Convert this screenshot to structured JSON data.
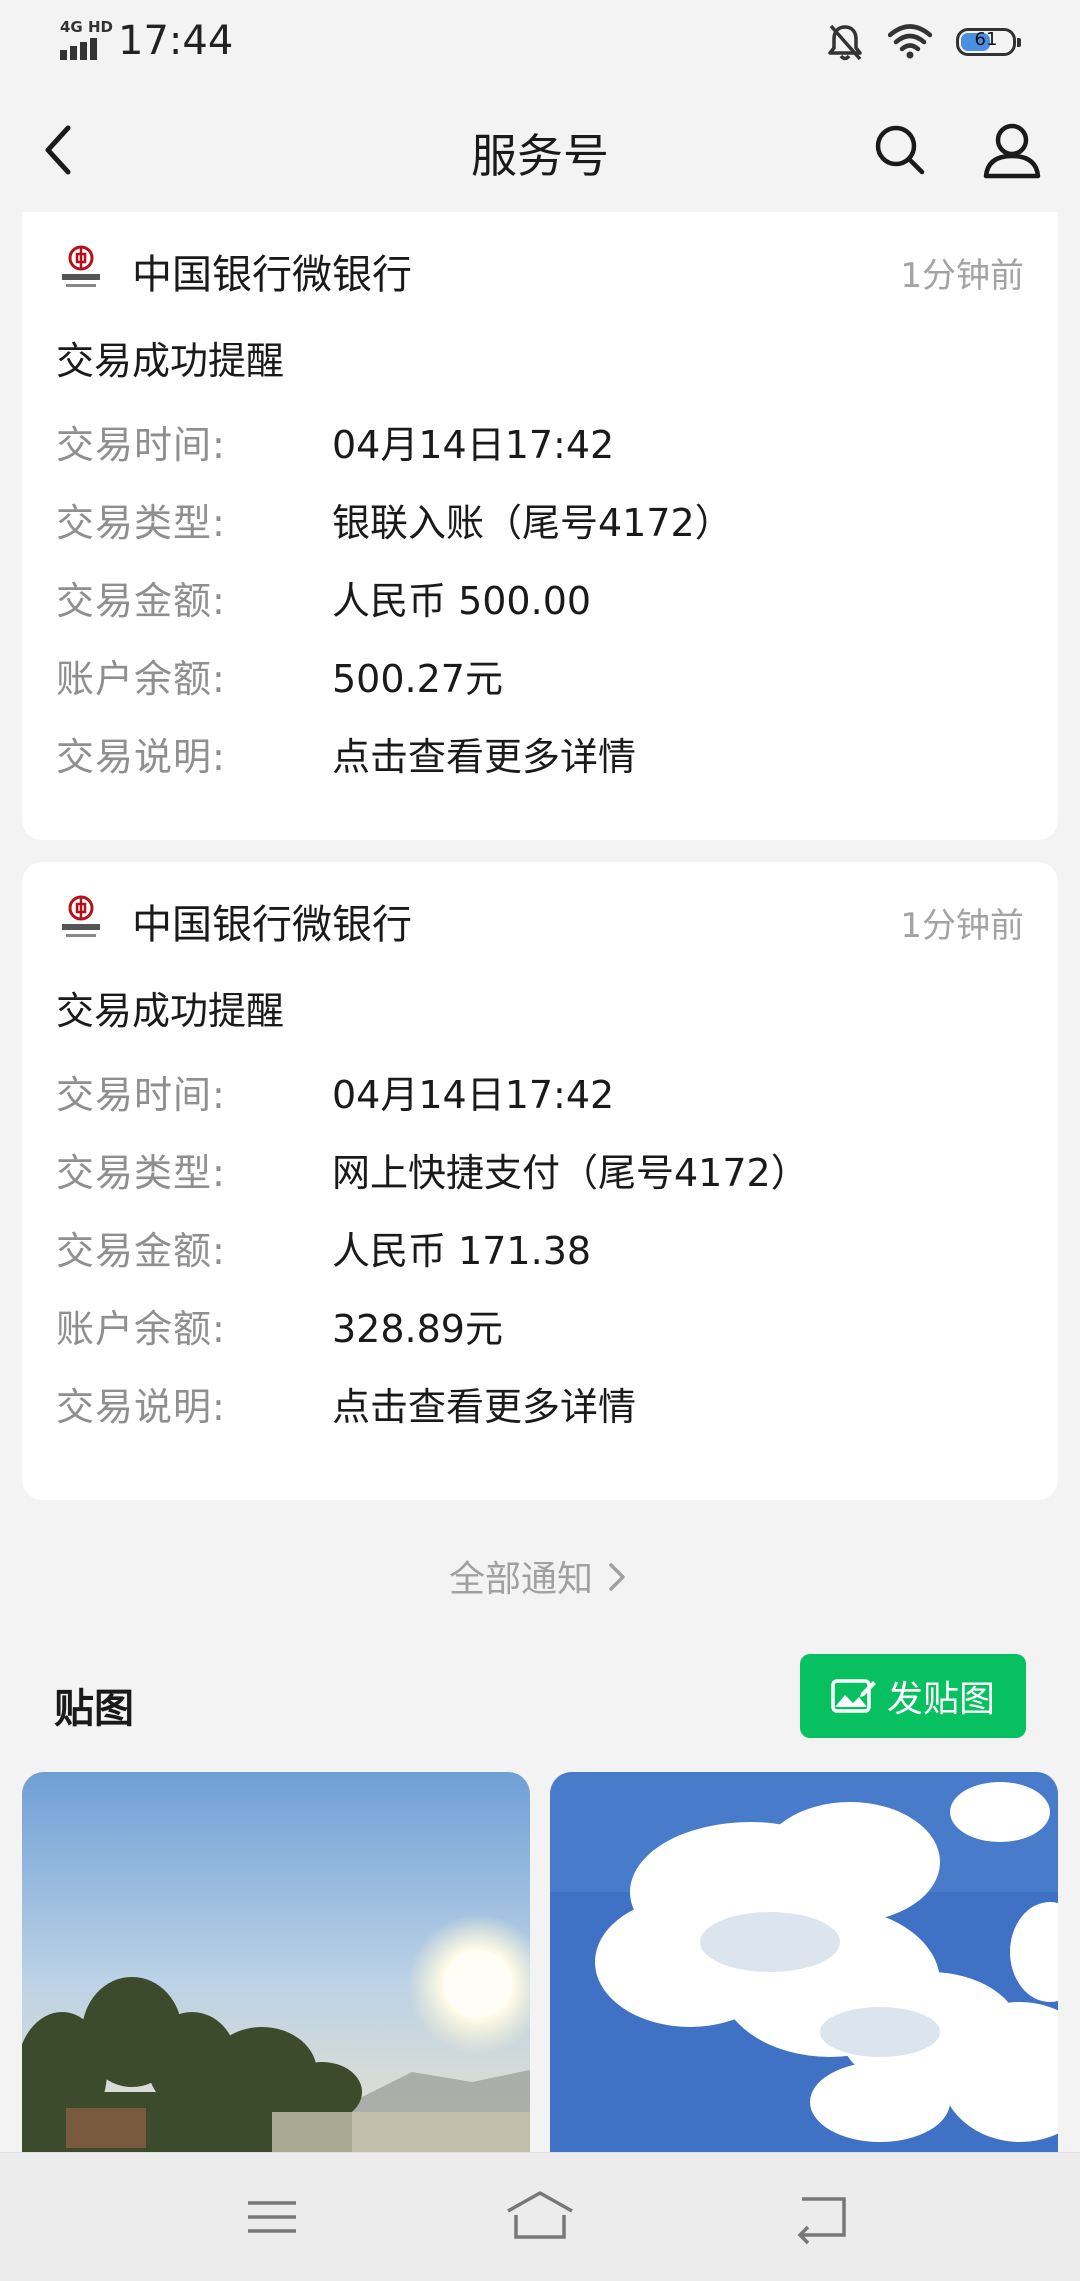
{
  "status_bar": {
    "network": "4G HD",
    "time": "17:44",
    "battery": "61",
    "battery_level": 0.61
  },
  "nav": {
    "title": "服务号"
  },
  "messages": [
    {
      "sender": "中国银行微银行",
      "time": "1分钟前",
      "title": "交易成功提醒",
      "rows": [
        {
          "label": "交易时间:",
          "value": "04月14日17:42"
        },
        {
          "label": "交易类型:",
          "value": "银联入账（尾号4172）"
        },
        {
          "label": "交易金额:",
          "value": "人民币 500.00"
        },
        {
          "label": "账户余额:",
          "value": "500.27元"
        },
        {
          "label": "交易说明:",
          "value": "点击查看更多详情"
        }
      ]
    },
    {
      "sender": "中国银行微银行",
      "time": "1分钟前",
      "title": "交易成功提醒",
      "rows": [
        {
          "label": "交易时间:",
          "value": "04月14日17:42"
        },
        {
          "label": "交易类型:",
          "value": "网上快捷支付（尾号4172）"
        },
        {
          "label": "交易金额:",
          "value": "人民币 171.38"
        },
        {
          "label": "账户余额:",
          "value": "328.89元"
        },
        {
          "label": "交易说明:",
          "value": "点击查看更多详情"
        }
      ]
    }
  ],
  "all_notices_label": "全部通知",
  "stickers": {
    "title": "贴图",
    "post_button_label": "发贴图",
    "accent_color": "#07c160"
  },
  "icons": {
    "back": "back-arrow-icon",
    "search": "search-icon",
    "profile": "profile-icon",
    "menu": "menu-icon",
    "home": "home-icon",
    "return": "return-icon"
  }
}
